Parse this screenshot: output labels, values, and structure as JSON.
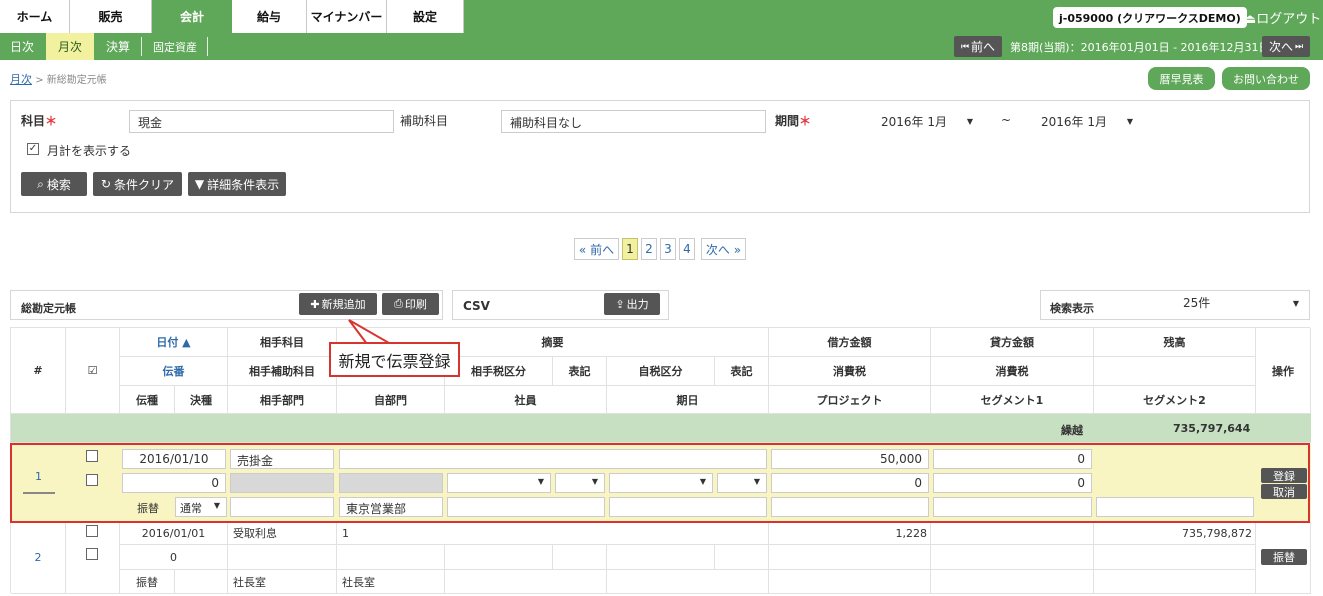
{
  "topnav": {
    "tabs": [
      "ホーム",
      "販売",
      "会計",
      "給与",
      "マイナンバー",
      "設定"
    ],
    "user": "j-059000 (クリアワークスDEMO)",
    "logout": "ログアウト"
  },
  "subnav": {
    "items": [
      "日次",
      "月次",
      "決算",
      "固定資産"
    ],
    "prev": "前へ",
    "next": "次へ",
    "period": "第8期(当期)：2016年01月01日 - 2016年12月31日"
  },
  "breadcrumb": {
    "link": "月次",
    "sep": ">",
    "current": "新総勘定元帳"
  },
  "top_buttons": {
    "calendar": "暦早見表",
    "contact": "お問い合わせ"
  },
  "filter": {
    "account_label": "科目",
    "account_value": "現金",
    "sub_label": "補助科目",
    "sub_value": "補助科目なし",
    "period_label": "期間",
    "from": "2016年 1月",
    "tilde": "~",
    "to": "2016年 1月",
    "monthly_total": "月計を表示する",
    "search": "検索",
    "clear": "条件クリア",
    "detail": "詳細条件表示"
  },
  "pager": {
    "prev": "« 前へ",
    "pages": [
      "1",
      "2",
      "3",
      "4"
    ],
    "next": "次へ »"
  },
  "bar": {
    "title": "総勘定元帳",
    "add": "新規追加",
    "print": "印刷",
    "csv": "CSV",
    "export": "出力",
    "display": "検索表示",
    "display_value": "25件"
  },
  "headers": {
    "no": "#",
    "check": "☑",
    "date": "日付 ▲",
    "voucher": "伝番",
    "kind": "伝種",
    "settle": "決種",
    "counter": "相手科目",
    "counter_sub": "相手補助科目",
    "counter_dept": "相手部門",
    "memo": "摘要",
    "counter_tax": "相手税区分",
    "notation1": "表記",
    "self_tax": "自税区分",
    "notation2": "表記",
    "self_dept": "自部門",
    "staff": "社員",
    "due": "期日",
    "debit": "借方金額",
    "debit_tax": "消費税",
    "project": "プロジェクト",
    "credit": "貸方金額",
    "credit_tax": "消費税",
    "segment1": "セグメント1",
    "balance": "残高",
    "segment2": "セグメント2",
    "ops": "操作"
  },
  "carry": {
    "label": "繰越",
    "value": "735,797,644"
  },
  "row1": {
    "no": "1",
    "date": "2016/01/10",
    "counter": "売掛金",
    "voucher": "0",
    "debit": "50,000",
    "credit": "0",
    "debit_tax": "0",
    "credit_tax": "0",
    "kind": "振替",
    "settle": "通常",
    "self_dept": "東京営業部",
    "register": "登録",
    "cancel": "取消"
  },
  "row2": {
    "no": "2",
    "date": "2016/01/01",
    "counter": "受取利息",
    "memo": "1",
    "voucher": "0",
    "credit": "1,228",
    "balance": "735,798,872",
    "kind": "振替",
    "counter_dept": "社長室",
    "self_dept": "社長室",
    "transfer": "振替"
  },
  "callout": "新規で伝票登録",
  "colors": {
    "brand_green": "#5fa85a",
    "highlight_yellow": "#f1f1a0",
    "alert_red": "#d8342f"
  }
}
